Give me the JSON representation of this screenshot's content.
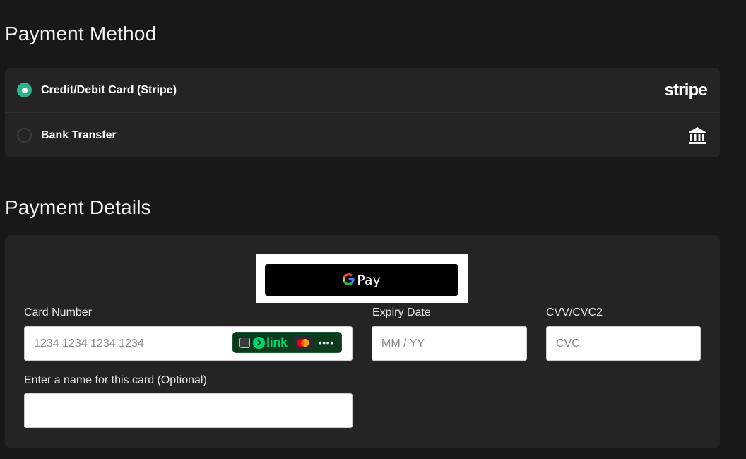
{
  "payment_method": {
    "title": "Payment Method",
    "options": [
      {
        "label": "Credit/Debit Card (Stripe)",
        "selected": true,
        "icon": "stripe-logo",
        "logo_text": "stripe"
      },
      {
        "label": "Bank Transfer",
        "selected": false,
        "icon": "bank-icon"
      }
    ],
    "accent_color": "#2bb58f"
  },
  "payment_details": {
    "title": "Payment Details",
    "gpay": {
      "label": "Pay",
      "icon": "google-g-icon"
    },
    "card_number": {
      "label": "Card Number",
      "placeholder": "1234 1234 1234 1234",
      "value": ""
    },
    "link_badge": {
      "text": "link",
      "dots": "••••",
      "icons": [
        "checkbox-icon",
        "link-arrow-icon",
        "mastercard-icon"
      ],
      "color": "#00d66f"
    },
    "expiry": {
      "label": "Expiry Date",
      "placeholder": "MM / YY",
      "value": ""
    },
    "cvv": {
      "label": "CVV/CVC2",
      "placeholder": "CVC",
      "value": ""
    },
    "card_name": {
      "label": "Enter a name for this card (Optional)",
      "placeholder": "",
      "value": ""
    }
  }
}
